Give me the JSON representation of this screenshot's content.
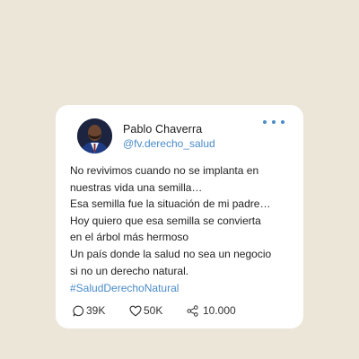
{
  "post": {
    "author_name": "Pablo Chaverra",
    "handle": "@fv.derecho_salud",
    "text_lines": [
      "No revivimos cuando no se implanta en",
      "nuestras vida una semilla…",
      "Esa semilla fue la situación de mi padre…",
      "Hoy quiero que esa semilla se convierta",
      "en el árbol más hermoso",
      "Un país donde la salud no sea un negocio",
      "si no un derecho natural."
    ],
    "hashtag": "#SaludDerechoNatural",
    "stats": {
      "replies": "39K",
      "likes": "50K",
      "shares": "10.000"
    }
  },
  "colors": {
    "background": "#ebe6d8",
    "card": "#ffffff",
    "accent": "#4a8bc9"
  },
  "icons": {
    "more": "more-dots-icon",
    "replies": "comment-bubble-icon",
    "likes": "heart-icon",
    "shares": "share-icon"
  }
}
